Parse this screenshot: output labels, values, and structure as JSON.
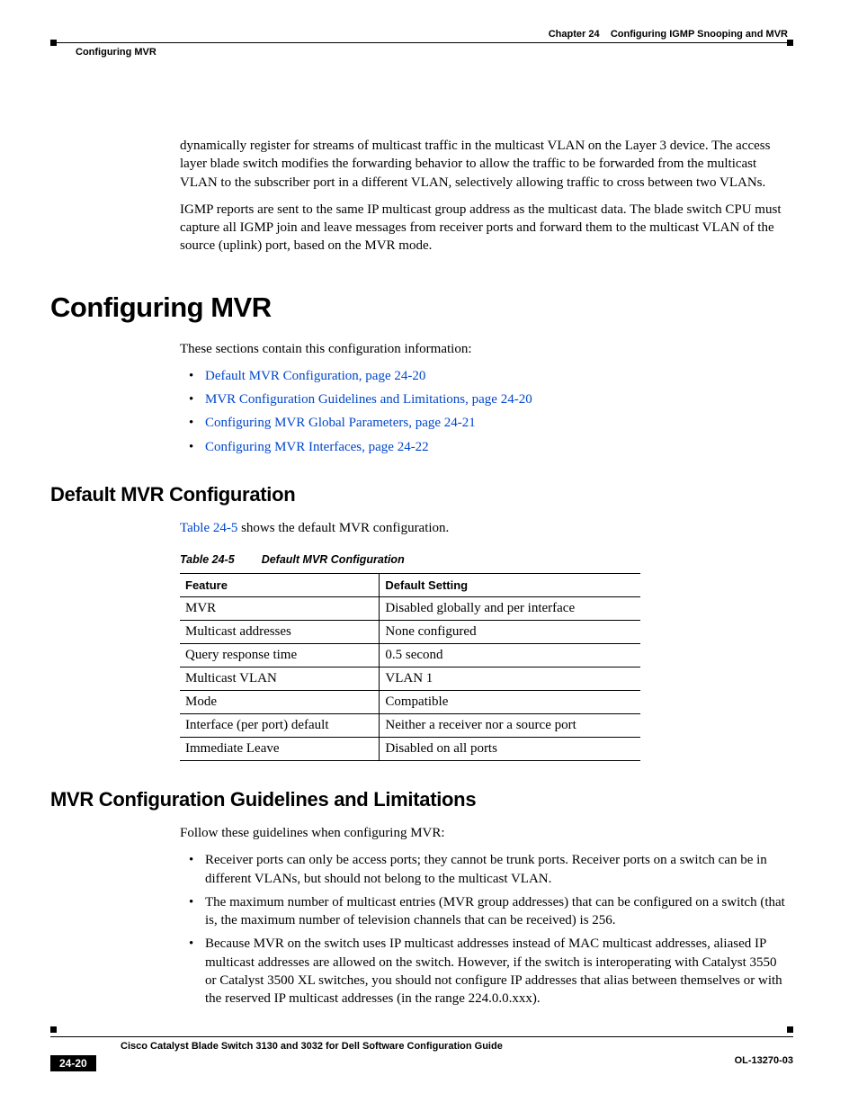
{
  "header": {
    "chapter": "Chapter 24",
    "chapter_title": "Configuring IGMP Snooping and MVR",
    "section": "Configuring MVR"
  },
  "body": {
    "p1": "dynamically register for streams of multicast traffic in the multicast VLAN on the Layer 3 device. The access layer blade switch modifies the forwarding behavior to allow the traffic to be forwarded from the multicast VLAN to the subscriber port in a different VLAN, selectively allowing traffic to cross between two VLANs.",
    "p2": "IGMP reports are sent to the same IP multicast group address as the multicast data. The blade switch CPU must capture all IGMP join and leave messages from receiver ports and forward them to the multicast VLAN of the source (uplink) port, based on the MVR mode.",
    "h1": "Configuring MVR",
    "p3": "These sections contain this configuration information:",
    "links": [
      "Default MVR Configuration, page 24-20",
      "MVR Configuration Guidelines and Limitations, page 24-20",
      "Configuring MVR Global Parameters, page 24-21",
      "Configuring MVR Interfaces, page 24-22"
    ],
    "h2a": "Default MVR Configuration",
    "p4_ref": "Table 24-5",
    "p4_rest": " shows the default MVR configuration.",
    "table": {
      "num": "Table 24-5",
      "caption": "Default MVR Configuration",
      "headers": [
        "Feature",
        "Default Setting"
      ],
      "rows": [
        [
          "MVR",
          "Disabled globally and per interface"
        ],
        [
          "Multicast addresses",
          "None configured"
        ],
        [
          "Query response time",
          "0.5 second"
        ],
        [
          "Multicast VLAN",
          "VLAN 1"
        ],
        [
          "Mode",
          "Compatible"
        ],
        [
          "Interface (per port) default",
          "Neither a receiver nor a source port"
        ],
        [
          "Immediate Leave",
          "Disabled on all ports"
        ]
      ]
    },
    "h2b": "MVR Configuration Guidelines and Limitations",
    "p5": "Follow these guidelines when configuring MVR:",
    "bullets2": [
      "Receiver ports can only be access ports; they cannot be trunk ports. Receiver ports on a switch can be in different VLANs, but should not belong to the multicast VLAN.",
      "The maximum number of multicast entries (MVR group addresses) that can be configured on a switch (that is, the maximum number of television channels that can be received) is 256.",
      "Because MVR on the switch uses IP multicast addresses instead of MAC multicast addresses, aliased IP multicast addresses are allowed on the switch. However, if the switch is interoperating with Catalyst 3550 or Catalyst 3500 XL switches, you should not configure IP addresses that alias between themselves or with the reserved IP multicast addresses (in the range 224.0.0.xxx)."
    ]
  },
  "footer": {
    "book": "Cisco Catalyst Blade Switch 3130 and 3032 for Dell Software Configuration Guide",
    "page": "24-20",
    "docid": "OL-13270-03"
  }
}
